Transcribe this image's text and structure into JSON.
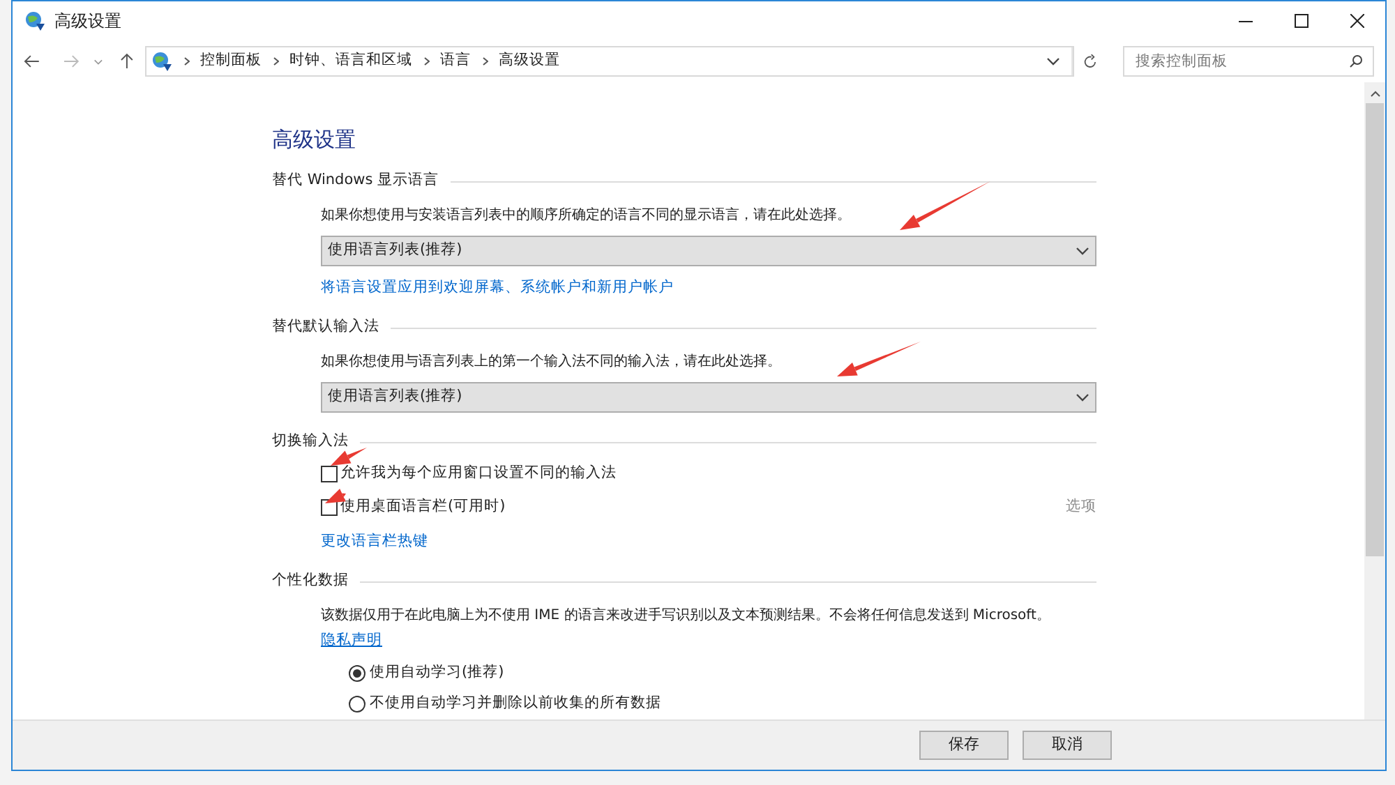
{
  "window": {
    "title": "高级设置"
  },
  "address_bar": {
    "crumbs": [
      "控制面板",
      "时钟、语言和区域",
      "语言",
      "高级设置"
    ]
  },
  "search": {
    "placeholder": "搜索控制面板"
  },
  "heading": "高级设置",
  "sections": [
    {
      "title": "替代 Windows 显示语言",
      "description": "如果你想使用与安装语言列表中的顺序所确定的语言不同的显示语言，请在此处选择。",
      "dropdown": {
        "value": "使用语言列表(推荐)"
      },
      "link": "将语言设置应用到欢迎屏幕、系统帐户和新用户帐户"
    },
    {
      "title": "替代默认输入法",
      "description": "如果你想使用与语言列表上的第一个输入法不同的输入法，请在此处选择。",
      "dropdown": {
        "value": "使用语言列表(推荐)"
      }
    },
    {
      "title": "切换输入法",
      "checkboxes": [
        {
          "label": "允许我为每个应用窗口设置不同的输入法",
          "checked": false
        },
        {
          "label": "使用桌面语言栏(可用时)",
          "checked": false,
          "option": "选项"
        }
      ],
      "link": "更改语言栏热键"
    },
    {
      "title": "个性化数据",
      "description": "该数据仅用于在此电脑上为不使用 IME 的语言来改进手写识别以及文本预测结果。不会将任何信息发送到 Microsoft。",
      "privacy_link": "隐私声明",
      "radios": [
        {
          "label": "使用自动学习(推荐)",
          "selected": true
        },
        {
          "label": "不使用自动学习并删除以前收集的所有数据",
          "selected": false
        }
      ]
    }
  ],
  "buttons": [
    "保存",
    "取消"
  ]
}
